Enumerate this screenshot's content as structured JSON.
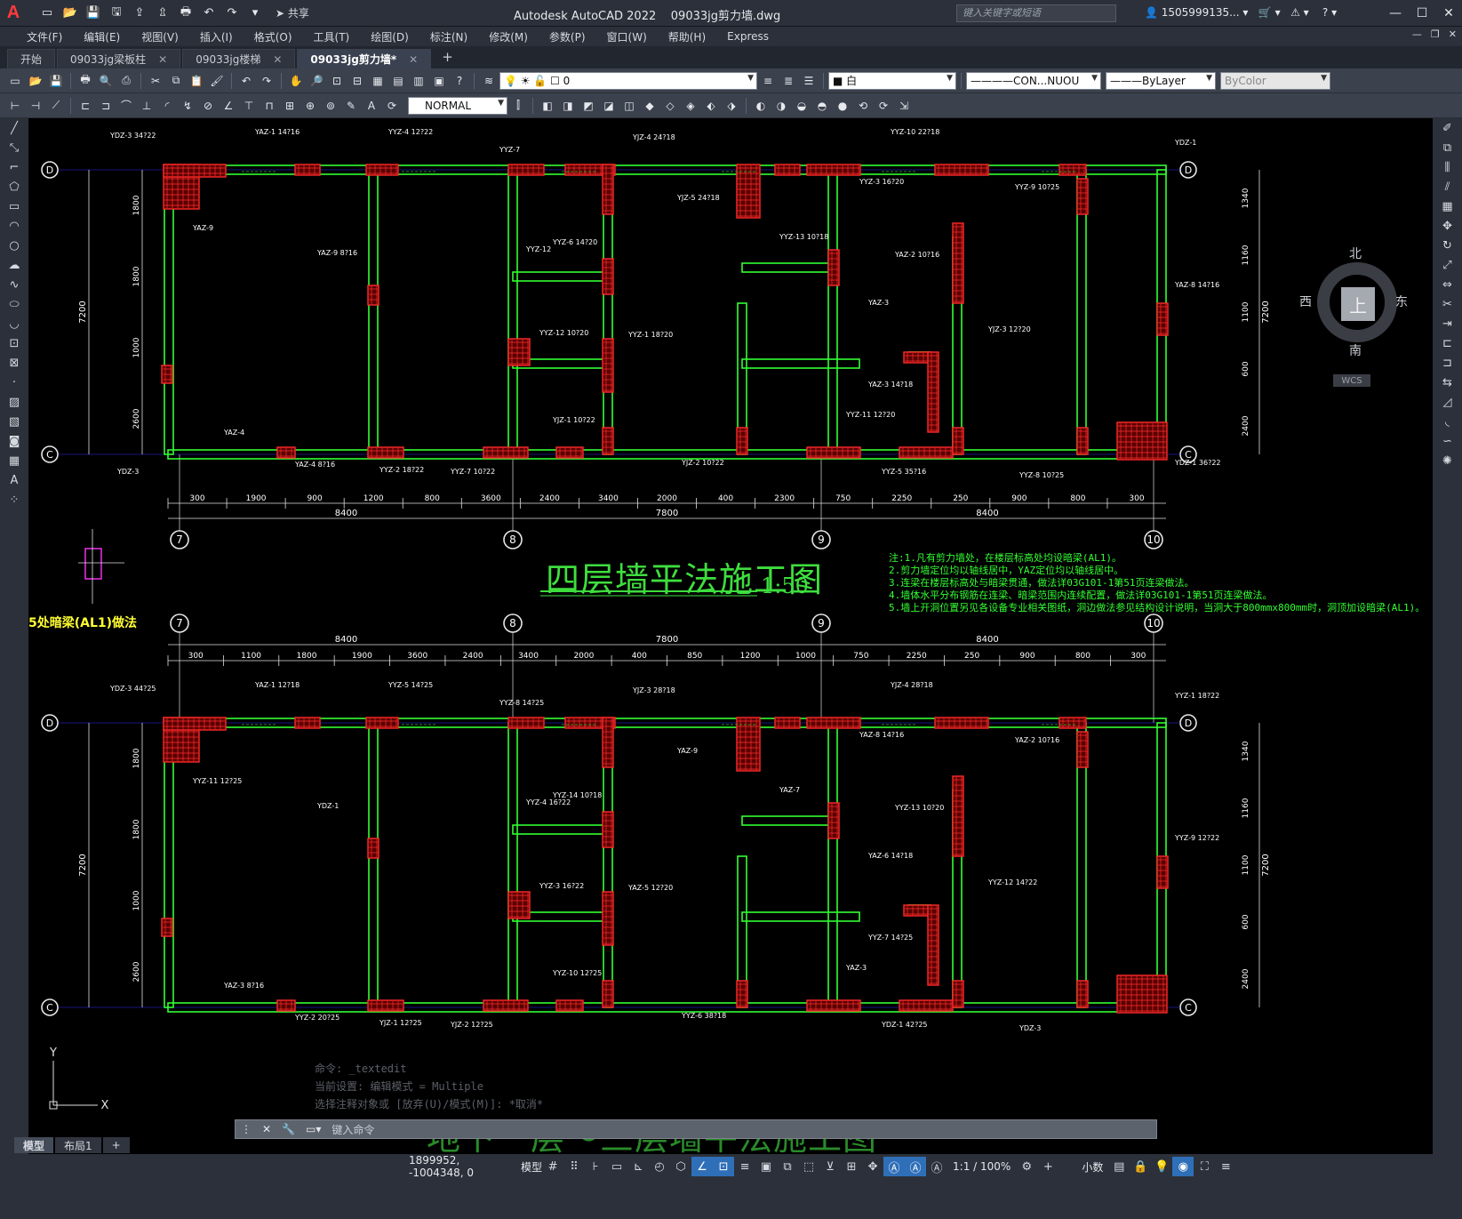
{
  "titlebar": {
    "logo": "A",
    "share_label": "共享",
    "app_title": "Autodesk AutoCAD 2022",
    "file_name": "09033jg剪力墙.dwg",
    "search_placeholder": "键入关键字或短语",
    "user": "1505999135..."
  },
  "menu": [
    "文件(F)",
    "编辑(E)",
    "视图(V)",
    "插入(I)",
    "格式(O)",
    "工具(T)",
    "绘图(D)",
    "标注(N)",
    "修改(M)",
    "参数(P)",
    "窗口(W)",
    "帮助(H)",
    "Express"
  ],
  "tabs": [
    {
      "label": "开始",
      "active": false
    },
    {
      "label": "09033jg梁板柱",
      "active": false
    },
    {
      "label": "09033jg楼梯",
      "active": false
    },
    {
      "label": "09033jg剪力墙*",
      "active": true
    }
  ],
  "toolbar": {
    "layer_value": "0",
    "color_value": "白",
    "linetype_value": "CON...NUOU",
    "lineweight_value": "ByLayer",
    "plotstyle_value": "ByColor",
    "dimstyle_value": "NORMAL"
  },
  "viewcube": {
    "north": "北",
    "south": "南",
    "east": "东",
    "west": "西",
    "face": "上",
    "wcs": "WCS"
  },
  "drawing": {
    "upper_title": "四层墙平法施工图",
    "upper_scale": "1:50",
    "lower_title": "地下一层～三层墙平法施工图",
    "detail_label": "5处暗梁(AL1)做法",
    "notes": [
      "注:1.凡有剪力墙处，在楼层标高处均设暗梁(AL1)。",
      "2.剪力墙定位均以轴线居中，YAZ定位均以轴线居中。",
      "3.连梁在楼层标高处与暗梁贯通，做法详03G101-1第51页连梁做法。",
      "4.墙体水平分布钢筋在连梁、暗梁范围内连续配置，做法详03G101-1第51页连梁做法。",
      "5.墙上开洞位置另见各设备专业相关图纸，洞边做法参见结构设计说明，当洞大于800mmx800mm时，洞顶加设暗梁(AL1)。"
    ],
    "grid_rows_upper": [
      "D",
      "C"
    ],
    "grid_cols": [
      "7",
      "8",
      "9",
      "10"
    ],
    "dims_bottom_upper": [
      "300",
      "1900",
      "900",
      "1200",
      "800",
      "3600",
      "2400",
      "3400",
      "2000",
      "400",
      "2300",
      "750",
      "2250",
      "250",
      "900",
      "800",
      "300"
    ],
    "dims_total": [
      "8400",
      "7800",
      "8400"
    ],
    "dims_left": [
      "1800",
      "1800",
      "1000",
      "2600"
    ],
    "dims_left_total": "7200",
    "dims_right": [
      "1340",
      "1160",
      "1100",
      "600",
      "2400"
    ],
    "dims_top_lower": [
      "300",
      "1100",
      "1800",
      "1900",
      "3600",
      "2400",
      "3400",
      "2000",
      "400",
      "850",
      "1200",
      "1000",
      "750",
      "2250",
      "250",
      "900",
      "800",
      "300"
    ],
    "wall_labels_upper": [
      "YDZ-3 34?22",
      "YAZ-1 14?16",
      "YYZ-4 12?22",
      "YYZ-7",
      "YJZ-4 24?18",
      "YYZ-10 22?18",
      "YDZ-1",
      "YAZ-9",
      "YAZ-9 8?16",
      "YYZ-12",
      "YYZ-6 14?20",
      "YJZ-5 24?18",
      "YYZ-13 10?18",
      "YYZ-3 16?20",
      "YYZ-9 10?25",
      "YAZ-8 14?16",
      "YAZ-2 10?16",
      "YYZ-12 10?20",
      "YYZ-1 18?20",
      "YAZ-3",
      "YJZ-3 12?20",
      "YAZ-3 14?18",
      "YJZ-1 10?22",
      "YYZ-11 12?20",
      "YAZ-4",
      "YAZ-4 8?16",
      "YYZ-2 18?22",
      "YYZ-7 10?22",
      "YJZ-2 10?22",
      "YYZ-5 35?16",
      "YYZ-8 10?25",
      "YDZ-1 36?22",
      "YDZ-3"
    ],
    "wall_labels_lower": [
      "YDZ-3 44?25",
      "YAZ-1 12?18",
      "YYZ-5 14?25",
      "YYZ-8 14?25",
      "YJZ-3 28?18",
      "YJZ-4 28?18",
      "YYZ-1 18?22",
      "YYZ-11 12?25",
      "YDZ-1",
      "YYZ-4 16?22",
      "YYZ-14 10?18",
      "YAZ-9",
      "YAZ-7",
      "YAZ-8 14?16",
      "YAZ-2 10?16",
      "YYZ-9 12?22",
      "YYZ-13 10?20",
      "YYZ-3 16?22",
      "YAZ-5 12?20",
      "YAZ-6 14?18",
      "YYZ-12 14?22",
      "YYZ-7 14?25",
      "YYZ-10 12?25",
      "YAZ-3",
      "YAZ-3 8?16",
      "YYZ-2 20?25",
      "YJZ-1 12?25",
      "YJZ-2 12?25",
      "YYZ-6 38?18",
      "YDZ-1 42?25",
      "YDZ-3"
    ]
  },
  "command": {
    "history": [
      "命令: _textedit",
      "当前设置: 编辑模式 = Multiple",
      "选择注释对象或 [放弃(U)/模式(M)]: *取消*"
    ],
    "placeholder": "键入命令"
  },
  "layout_tabs": [
    {
      "label": "模型",
      "active": true
    },
    {
      "label": "布局1",
      "active": false
    }
  ],
  "status": {
    "coordinates": "1899952, -1004348, 0",
    "space": "模型",
    "annotation_scale": "1:1 / 100%",
    "units": "小数"
  }
}
